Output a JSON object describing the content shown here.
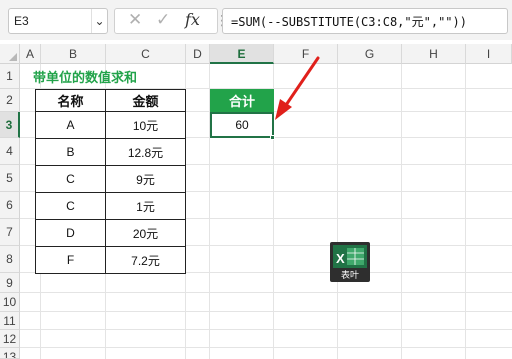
{
  "name_box": {
    "value": "E3",
    "dropdown_glyph": "⌄"
  },
  "formula_toolbar": {
    "separator_glyph": "⋮",
    "cancel_glyph": "✕",
    "enter_glyph": "✓",
    "fx_label": "fx"
  },
  "formula_bar": {
    "value": "=SUM(--SUBSTITUTE(C3:C8,\"元\",\"\"))"
  },
  "columns": [
    "A",
    "B",
    "C",
    "D",
    "E",
    "F",
    "G",
    "H",
    "I"
  ],
  "rows": [
    "1",
    "2",
    "3",
    "4",
    "5",
    "6",
    "7",
    "8",
    "9",
    "10",
    "11",
    "12",
    "13"
  ],
  "selected_cell": "E3",
  "sheet": {
    "title": "带单位的数值求和",
    "table": {
      "headers": [
        "名称",
        "金额"
      ],
      "rows": [
        [
          "A",
          "10元"
        ],
        [
          "B",
          "12.8元"
        ],
        [
          "C",
          "9元"
        ],
        [
          "C",
          "1元"
        ],
        [
          "D",
          "20元"
        ],
        [
          "F",
          "7.2元"
        ]
      ]
    },
    "sum_block": {
      "header": "合计",
      "value": "60"
    }
  },
  "watermark": {
    "icon": "excel-logo-icon",
    "letter": "X",
    "label": "表叶"
  },
  "colors": {
    "accent_green": "#22a34a",
    "excel_green": "#217346",
    "arrow_red": "#e0201b"
  }
}
